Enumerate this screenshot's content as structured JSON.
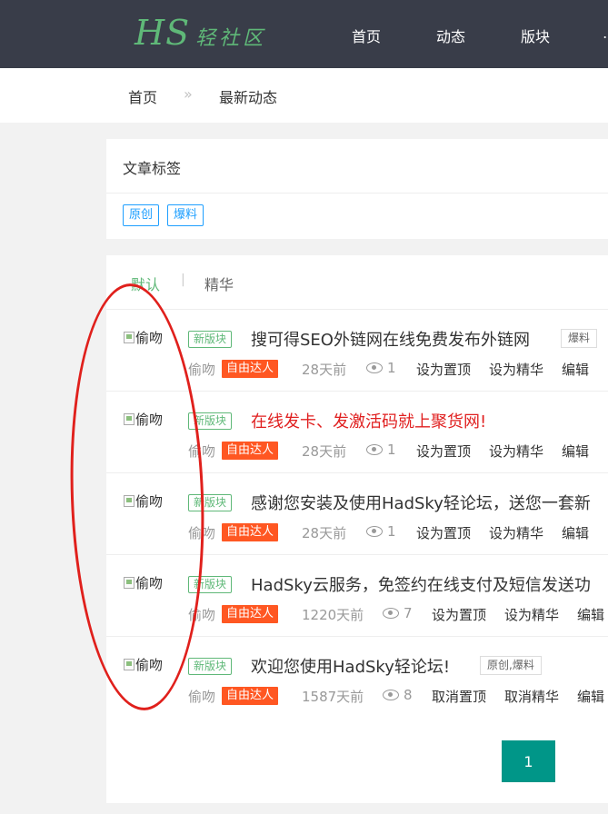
{
  "header": {
    "logo_main": "HS",
    "logo_sub": "轻社区",
    "nav": [
      "首页",
      "动态",
      "版块"
    ],
    "nav_more": "…"
  },
  "breadcrumb": {
    "home": "首页",
    "sep": "»",
    "current": "最新动态"
  },
  "tags_panel": {
    "title": "文章标签",
    "tags": [
      "原创",
      "爆料"
    ]
  },
  "tabs": {
    "default": "默认",
    "sep": "|",
    "digest": "精华"
  },
  "posts": [
    {
      "avatar_alt": "偷吻",
      "board": "新版块",
      "title": "搜可得SEO外链网在线免费发布外链网",
      "labels": "爆料",
      "author": "偷吻",
      "badge": "自由达人",
      "time": "28天前",
      "views": "1",
      "actions": [
        "设为置顶",
        "设为精华",
        "编辑"
      ]
    },
    {
      "avatar_alt": "偷吻",
      "board": "新版块",
      "title": "在线发卡、发激活码就上聚货网!",
      "labels": "",
      "author": "偷吻",
      "badge": "自由达人",
      "time": "28天前",
      "views": "1",
      "actions": [
        "设为置顶",
        "设为精华",
        "编辑"
      ]
    },
    {
      "avatar_alt": "偷吻",
      "board": "新版块",
      "title": "感谢您安装及使用HadSky轻论坛，送您一套新",
      "labels": "",
      "author": "偷吻",
      "badge": "自由达人",
      "time": "28天前",
      "views": "1",
      "actions": [
        "设为置顶",
        "设为精华",
        "编辑"
      ]
    },
    {
      "avatar_alt": "偷吻",
      "board": "新版块",
      "title": "HadSky云服务，免签约在线支付及短信发送功",
      "labels": "",
      "author": "偷吻",
      "badge": "自由达人",
      "time": "1220天前",
      "views": "7",
      "actions": [
        "设为置顶",
        "设为精华",
        "编辑"
      ]
    },
    {
      "avatar_alt": "偷吻",
      "board": "新版块",
      "title": "欢迎您使用HadSky轻论坛!",
      "labels": "原创,爆料",
      "author": "偷吻",
      "badge": "自由达人",
      "time": "1587天前",
      "views": "8",
      "actions": [
        "取消置顶",
        "取消精华",
        "编辑"
      ]
    }
  ],
  "pagination": {
    "current": "1"
  },
  "colors": {
    "header_bg": "#393d49",
    "accent_green": "#5fb878",
    "badge_orange": "#ff5722",
    "page_btn": "#009688",
    "annotation_red": "#e0201c"
  }
}
